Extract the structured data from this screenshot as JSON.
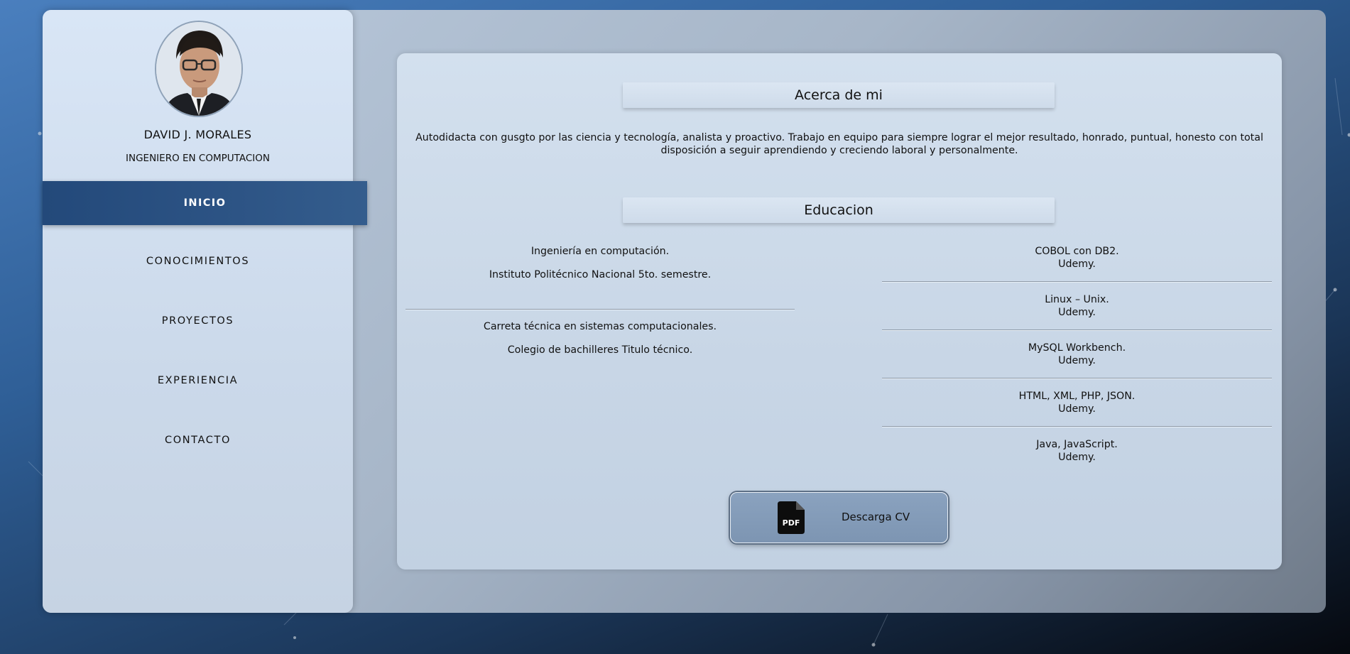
{
  "profile": {
    "name": "DAVID J. MORALES",
    "title": "INGENIERO EN COMPUTACION"
  },
  "nav": {
    "items": [
      {
        "label": "INICIO",
        "active": true
      },
      {
        "label": "CONOCIMIENTOS",
        "active": false
      },
      {
        "label": "PROYECTOS",
        "active": false
      },
      {
        "label": "EXPERIENCIA",
        "active": false
      },
      {
        "label": "CONTACTO",
        "active": false
      }
    ]
  },
  "about": {
    "heading": "Acerca de mi",
    "text": "Autodidacta con gusgto por las ciencia y tecnología, analista y proactivo. Trabajo en equipo para siempre lograr el mejor resultado, honrado, puntual, honesto con total disposición a seguir aprendiendo y creciendo laboral y personalmente."
  },
  "education": {
    "heading": "Educacion",
    "formal": [
      {
        "degree": "Ingeniería en computación.",
        "school": "Instituto Politécnico Nacional 5to. semestre."
      },
      {
        "degree": "Carreta técnica en sistemas computacionales.",
        "school": "Colegio de bachilleres Titulo técnico."
      }
    ],
    "courses": [
      {
        "name": "COBOL con DB2.",
        "provider": "Udemy."
      },
      {
        "name": "Linux – Unix.",
        "provider": "Udemy."
      },
      {
        "name": "MySQL Workbench.",
        "provider": "Udemy."
      },
      {
        "name": "HTML, XML, PHP, JSON.",
        "provider": "Udemy."
      },
      {
        "name": "Java, JavaScript.",
        "provider": "Udemy."
      }
    ]
  },
  "cv_button": {
    "icon_label": "PDF",
    "label": "Descarga CV"
  },
  "icons": {
    "pdf": "file-pdf-icon",
    "avatar": "profile-photo"
  },
  "colors": {
    "nav_active": "#2d5485",
    "cv_button": "#8aa2bf",
    "sidebar": "#d3e1f1",
    "content_card": "#c8d6e6"
  }
}
